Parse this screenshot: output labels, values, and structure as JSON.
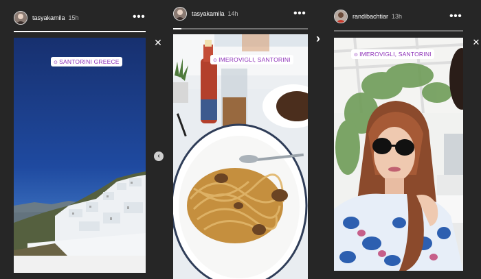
{
  "stories": [
    {
      "username": "tasyakamila",
      "timestamp": "15h",
      "location_tag": "SANTORINI GREECE",
      "progress": 1.0
    },
    {
      "username": "tasyakamila",
      "timestamp": "14h",
      "location_tag": "IMEROVIGLI, SANTORINI",
      "progress": 0.06
    },
    {
      "username": "randibachtiar",
      "timestamp": "13h",
      "location_tag": "IMEROVIGLI, SANTORINI",
      "progress": 0.0
    }
  ],
  "icons": {
    "more": "more-options-icon",
    "close": "close-icon",
    "next": "chevron-right-icon",
    "prev": "chevron-left-icon",
    "location": "location-pin-icon"
  },
  "colors": {
    "background": "#262626",
    "tag_text": "#8c2fb8"
  },
  "glyphs": {
    "more": "•••",
    "close": "✕",
    "next": "›",
    "pin": "⊙"
  }
}
